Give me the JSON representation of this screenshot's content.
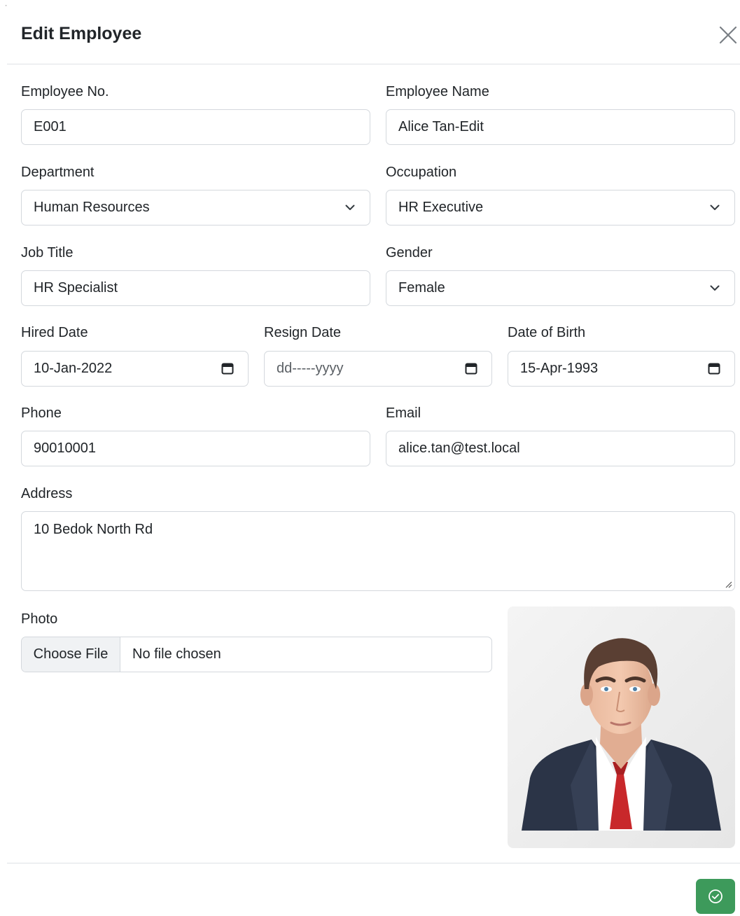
{
  "dialog": {
    "title": "Edit Employee",
    "close_icon": "close-icon"
  },
  "fields": {
    "employee_no": {
      "label": "Employee No.",
      "value": "E001"
    },
    "employee_name": {
      "label": "Employee Name",
      "value": "Alice Tan-Edit"
    },
    "department": {
      "label": "Department",
      "value": "Human Resources"
    },
    "occupation": {
      "label": "Occupation",
      "value": "HR Executive"
    },
    "job_title": {
      "label": "Job Title",
      "value": "HR Specialist"
    },
    "gender": {
      "label": "Gender",
      "value": "Female"
    },
    "hired_date": {
      "label": "Hired Date",
      "value": "10-Jan-2022"
    },
    "resign_date": {
      "label": "Resign Date",
      "placeholder": "dd-----yyyy"
    },
    "date_of_birth": {
      "label": "Date of Birth",
      "value": "15-Apr-1993"
    },
    "phone": {
      "label": "Phone",
      "value": "90010001"
    },
    "email": {
      "label": "Email",
      "value": "alice.tan@test.local"
    },
    "address": {
      "label": "Address",
      "value": "10 Bedok North Rd"
    },
    "photo": {
      "label": "Photo",
      "button_label": "Choose File",
      "file_status": "No file chosen"
    }
  },
  "footer": {
    "save_icon": "check-circle-icon",
    "save_color": "#3d9a5b"
  },
  "top_left_mark": "'"
}
